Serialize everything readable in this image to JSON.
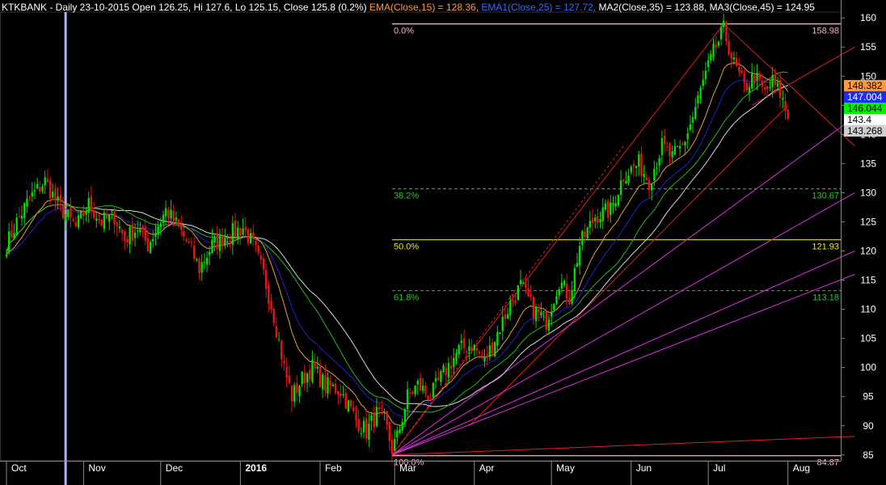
{
  "header": {
    "title": "KTKBANK - Daily 23-10-2015 Open 126.25, Hi 127.6, Lo 125.15, Close 125.8 (0.2%)",
    "ema15": "EMA(Close,15) = 128.36,",
    "ema25": "EMA1(Close,25) = 127.72,",
    "ma35": "MA2(Close,35) = 123.88,",
    "ma45": "MA3(Close,45) = 124.95"
  },
  "colors": {
    "background": "#000000",
    "candle_up": "#00dd00",
    "candle_down": "#ee1111",
    "ema15": "#e8a030",
    "ema25": "#2323c8",
    "ma35": "#22bb22",
    "ma45": "#d8d8d8",
    "fib_100": "#ffb0c8",
    "fib_618": "#22cc22",
    "fib_50": "#f0f000",
    "trend_red": "#e02020",
    "fan_magenta": "#e030e0",
    "header_text": "#ffffff",
    "ema15_label": "#ff9a3a",
    "ema25_label": "#3a6aff",
    "ma_label": "#ffffff"
  },
  "chart_data": {
    "type": "candlestick",
    "symbol": "KTKBANK",
    "interval": "Daily",
    "ylim": [
      84,
      161
    ],
    "y_ticks": [
      85,
      90,
      95,
      100,
      105,
      110,
      115,
      120,
      125,
      130,
      135,
      140,
      145,
      150,
      155,
      160
    ],
    "months": [
      {
        "label": "Oct",
        "day": 0
      },
      {
        "label": "Nov",
        "day": 30
      },
      {
        "label": "Dec",
        "day": 60
      },
      {
        "label": "2016",
        "day": 91
      },
      {
        "label": "Feb",
        "day": 122
      },
      {
        "label": "Mar",
        "day": 151
      },
      {
        "label": "Apr",
        "day": 182
      },
      {
        "label": "May",
        "day": 212
      },
      {
        "label": "Jun",
        "day": 243
      },
      {
        "label": "Jul",
        "day": 273
      },
      {
        "label": "Aug",
        "day": 304
      }
    ],
    "cursor_day": 23,
    "fib_levels": [
      {
        "pct": "0.0%",
        "value": 158.98
      },
      {
        "pct": "38.2%",
        "value": 130.67
      },
      {
        "pct": "50.0%",
        "value": 121.93
      },
      {
        "pct": "61.8%",
        "value": 113.18
      },
      {
        "pct": "100.0%",
        "value": 84.87
      }
    ],
    "price_labels": [
      {
        "value": 148.382,
        "text": "148.382",
        "bg": "#ff9a3a",
        "fg": "#000000"
      },
      {
        "value": 147.004,
        "text": "147.004",
        "bg": "#1a2ef0",
        "fg": "#ffffff"
      },
      {
        "value": 146.044,
        "text": "146.044",
        "bg": "#00ee00",
        "fg": "#000000"
      },
      {
        "value": 143.4,
        "text": "143.4",
        "bg": "#ffffff",
        "fg": "#000000"
      },
      {
        "value": 143.268,
        "text": "143.268",
        "bg": "#d0d0d0",
        "fg": "#000000"
      }
    ],
    "anchors": [
      [
        0,
        121
      ],
      [
        4,
        125
      ],
      [
        9,
        129
      ],
      [
        15,
        132
      ],
      [
        20,
        128
      ],
      [
        27,
        124
      ],
      [
        32,
        128
      ],
      [
        37,
        125
      ],
      [
        42,
        126
      ],
      [
        46,
        122
      ],
      [
        51,
        124
      ],
      [
        55,
        121
      ],
      [
        62,
        127
      ],
      [
        67,
        124
      ],
      [
        72,
        120
      ],
      [
        75,
        117
      ],
      [
        80,
        121
      ],
      [
        87,
        123
      ],
      [
        92,
        124
      ],
      [
        96,
        121
      ],
      [
        100,
        116
      ],
      [
        104,
        109
      ],
      [
        108,
        100
      ],
      [
        111,
        95
      ],
      [
        115,
        98
      ],
      [
        119,
        100
      ],
      [
        124,
        97
      ],
      [
        130,
        96
      ],
      [
        136,
        91
      ],
      [
        140,
        89
      ],
      [
        144,
        92
      ],
      [
        147,
        91
      ],
      [
        150,
        86
      ],
      [
        152,
        88
      ],
      [
        156,
        95
      ],
      [
        160,
        97
      ],
      [
        165,
        95
      ],
      [
        170,
        99
      ],
      [
        176,
        103
      ],
      [
        181,
        104
      ],
      [
        186,
        101
      ],
      [
        191,
        106
      ],
      [
        196,
        111
      ],
      [
        200,
        114
      ],
      [
        205,
        110
      ],
      [
        210,
        108
      ],
      [
        215,
        115
      ],
      [
        219,
        112
      ],
      [
        223,
        121
      ],
      [
        229,
        126
      ],
      [
        235,
        127
      ],
      [
        240,
        133
      ],
      [
        246,
        135
      ],
      [
        250,
        132
      ],
      [
        255,
        138
      ],
      [
        259,
        136
      ],
      [
        263,
        138
      ],
      [
        267,
        143
      ],
      [
        271,
        149
      ],
      [
        275,
        154
      ],
      [
        279,
        158
      ],
      [
        283,
        152
      ],
      [
        287,
        148
      ],
      [
        291,
        150
      ],
      [
        295,
        147
      ],
      [
        298,
        149
      ],
      [
        301,
        147
      ],
      [
        304,
        143
      ]
    ],
    "trendlines_red": [
      {
        "from": [
          150,
          85
        ],
        "to": [
          279,
          158.98
        ]
      },
      {
        "from": [
          150,
          85
        ],
        "to": [
          330,
          88.2
        ]
      },
      {
        "from": [
          279,
          158.98
        ],
        "to": [
          330,
          138
        ]
      },
      {
        "from": [
          290,
          145
        ],
        "to": [
          330,
          155
        ]
      },
      {
        "from": [
          180,
          90
        ],
        "to": [
          304,
          145
        ]
      }
    ],
    "fan_lines": [
      {
        "from": [
          150,
          85
        ],
        "to": [
          330,
          143
        ]
      },
      {
        "from": [
          150,
          85
        ],
        "to": [
          330,
          130
        ]
      },
      {
        "from": [
          150,
          85
        ],
        "to": [
          330,
          120
        ]
      },
      {
        "from": [
          150,
          85
        ],
        "to": [
          330,
          116
        ]
      }
    ]
  }
}
